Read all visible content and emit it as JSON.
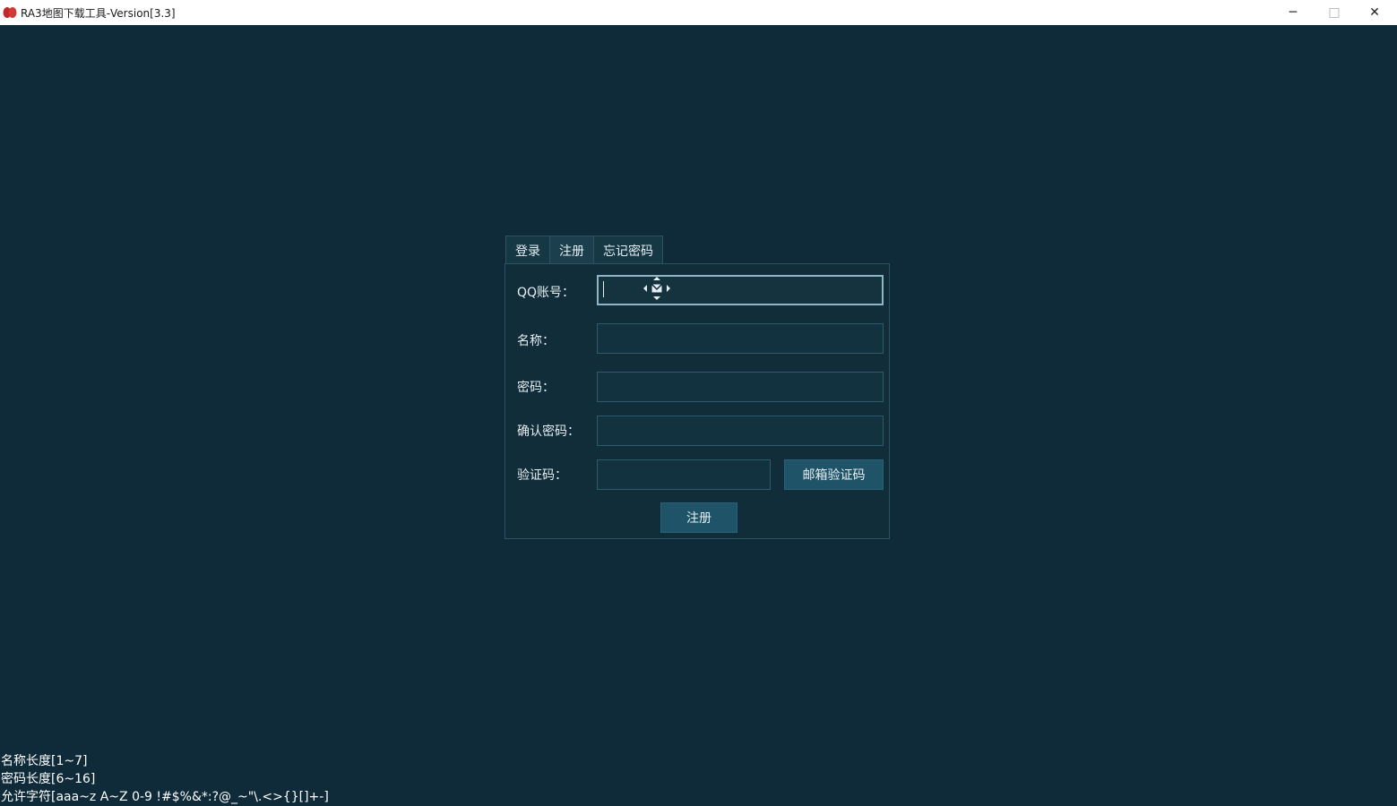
{
  "window": {
    "title": "RA3地图下载工具-Version[3.3]",
    "minimize_glyph": "─",
    "maximize_glyph": "□",
    "close_glyph": "✕"
  },
  "tabs": [
    {
      "label": "登录",
      "active": false
    },
    {
      "label": "注册",
      "active": true
    },
    {
      "label": "忘记密码",
      "active": false
    }
  ],
  "form": {
    "qq_label": "QQ账号：",
    "qq_value": "",
    "name_label": "名称：",
    "name_value": "",
    "password_label": "密码：",
    "password_value": "",
    "confirm_label": "确认密码：",
    "confirm_value": "",
    "code_label": "验证码：",
    "code_value": "",
    "send_code_button": "邮箱验证码",
    "register_button": "注册"
  },
  "hints": {
    "name_length": "名称长度[1~7]",
    "password_length": "密码长度[6~16]",
    "allowed_chars": "允许字符[aaa~z A~Z 0-9 !#$%&*:?@_~\"\\.<>{}[]+-]"
  },
  "colors": {
    "background": "#0f2a38",
    "field_bg": "#13323f",
    "button_bg": "#1f5468",
    "text": "#e6eef2"
  }
}
